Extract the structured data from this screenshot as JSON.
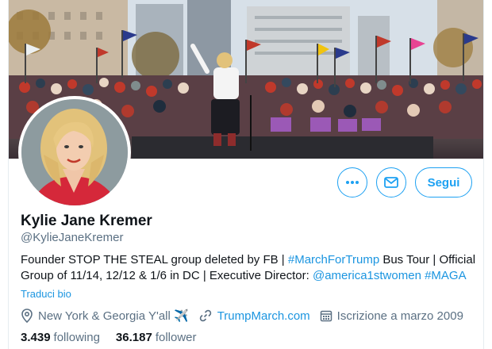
{
  "profile": {
    "name": "Kylie Jane Kremer",
    "handle": "@KylieJaneKremer",
    "bio_text_1": "Founder STOP THE STEAL group deleted by FB | ",
    "bio_hashtag_1": "#MarchForTrump",
    "bio_text_2": " Bus Tour | Official Group of 11/14, 12/12 & 1/6 in DC | Executive Director: ",
    "bio_mention": "@america1stwomen",
    "bio_text_3": " ",
    "bio_hashtag_2": "#MAGA",
    "translate_label": "Traduci bio",
    "location": "New York & Georgia Y'all ✈️",
    "website": "TrumpMarch.com",
    "joined": "Iscrizione a marzo 2009"
  },
  "actions": {
    "follow_label": "Segui",
    "more_icon": "more-icon",
    "message_icon": "envelope-icon"
  },
  "stats": {
    "following_count": "3.439",
    "following_label": "following",
    "followers_count": "36.187",
    "followers_label": "follower"
  },
  "colors": {
    "accent": "#1da1f2",
    "link": "#1b95e0",
    "secondary_text": "#5b7083"
  }
}
